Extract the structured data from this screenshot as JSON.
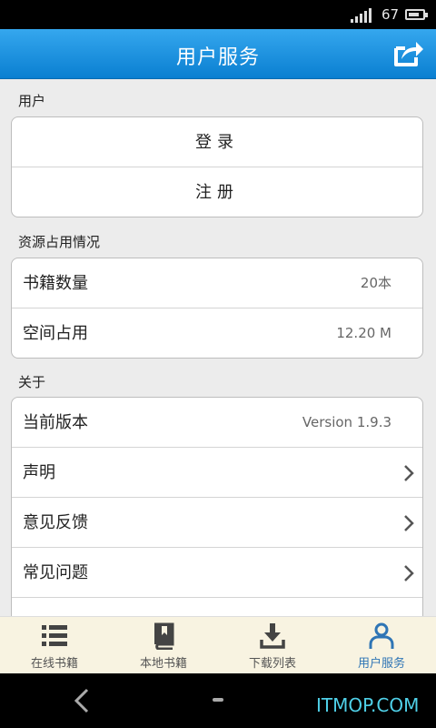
{
  "status_bar": {
    "battery": "67",
    "signal_icon": "signal-icon",
    "battery_icon": "battery-icon"
  },
  "header": {
    "title": "用户服务",
    "share_icon": "share-icon"
  },
  "user_section": {
    "label": "用户",
    "login": "登录",
    "register": "注册"
  },
  "resource_section": {
    "label": "资源占用情况",
    "rows": [
      {
        "label": "书籍数量",
        "value": "20本"
      },
      {
        "label": "空间占用",
        "value": "12.20 M"
      }
    ]
  },
  "about_section": {
    "label": "关于",
    "version_label": "当前版本",
    "version_value": "Version 1.9.3",
    "items": [
      "声明",
      "意见反馈",
      "常见问题"
    ]
  },
  "bottom_nav": {
    "tabs": [
      {
        "label": "在线书籍",
        "icon": "list-icon"
      },
      {
        "label": "本地书籍",
        "icon": "book-icon"
      },
      {
        "label": "下载列表",
        "icon": "download-icon"
      },
      {
        "label": "用户服务",
        "icon": "user-icon"
      }
    ],
    "active_index": 3
  },
  "watermark": "ITMOP.COM",
  "colors": {
    "header": "#1a8fdf",
    "active_tab": "#2f75b5",
    "nav_bg": "#f8f3e1"
  }
}
